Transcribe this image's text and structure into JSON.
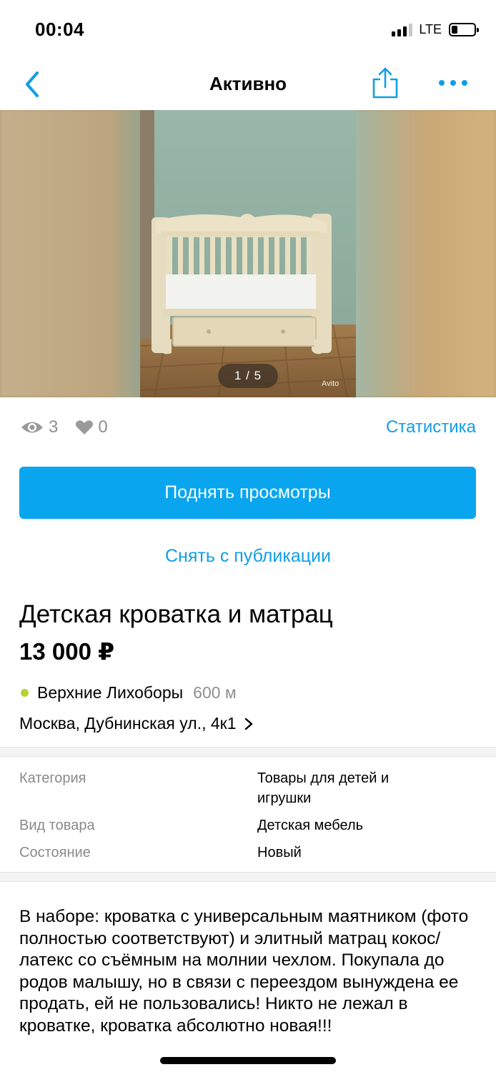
{
  "status_bar": {
    "time": "00:04",
    "network": "LTE",
    "battery_level": 0.25
  },
  "nav": {
    "title": "Активно",
    "back_icon": "chevron-left-icon",
    "share_icon": "share-icon",
    "more_icon": "more-dots-icon",
    "accent_color": "#109ee4"
  },
  "photo": {
    "counter": "1 / 5",
    "watermark": "Avito"
  },
  "stats": {
    "views": "3",
    "likes": "0",
    "link_label": "Статистика"
  },
  "actions": {
    "promote_label": "Поднять просмотры",
    "promote_color": "#0aa5ef",
    "unpublish_label": "Снять с публикации"
  },
  "item": {
    "title": "Детская кроватка и матрац",
    "price": "13 000 ₽"
  },
  "location": {
    "metro": "Верхние Лихоборы",
    "metro_distance": "600 м",
    "metro_color": "#b5d136",
    "address": "Москва, Дубнинская ул., 4к1"
  },
  "params": [
    {
      "label": "Категория",
      "value": "Товары для детей и игрушки"
    },
    {
      "label": "Вид товара",
      "value": "Детская мебель"
    },
    {
      "label": "Состояние",
      "value": "Новый"
    }
  ],
  "description": "В наборе: кроватка с универсальным маятником (фото полностью соответствуют) и элитный матрац кокос/латекс со съёмным на молнии чехлом. Покупала до родов малышу, но в связи с переездом вынуждена ее продать, ей не пользовались! Никто не лежал в кроватке, кроватка абсолютно новая!!!"
}
